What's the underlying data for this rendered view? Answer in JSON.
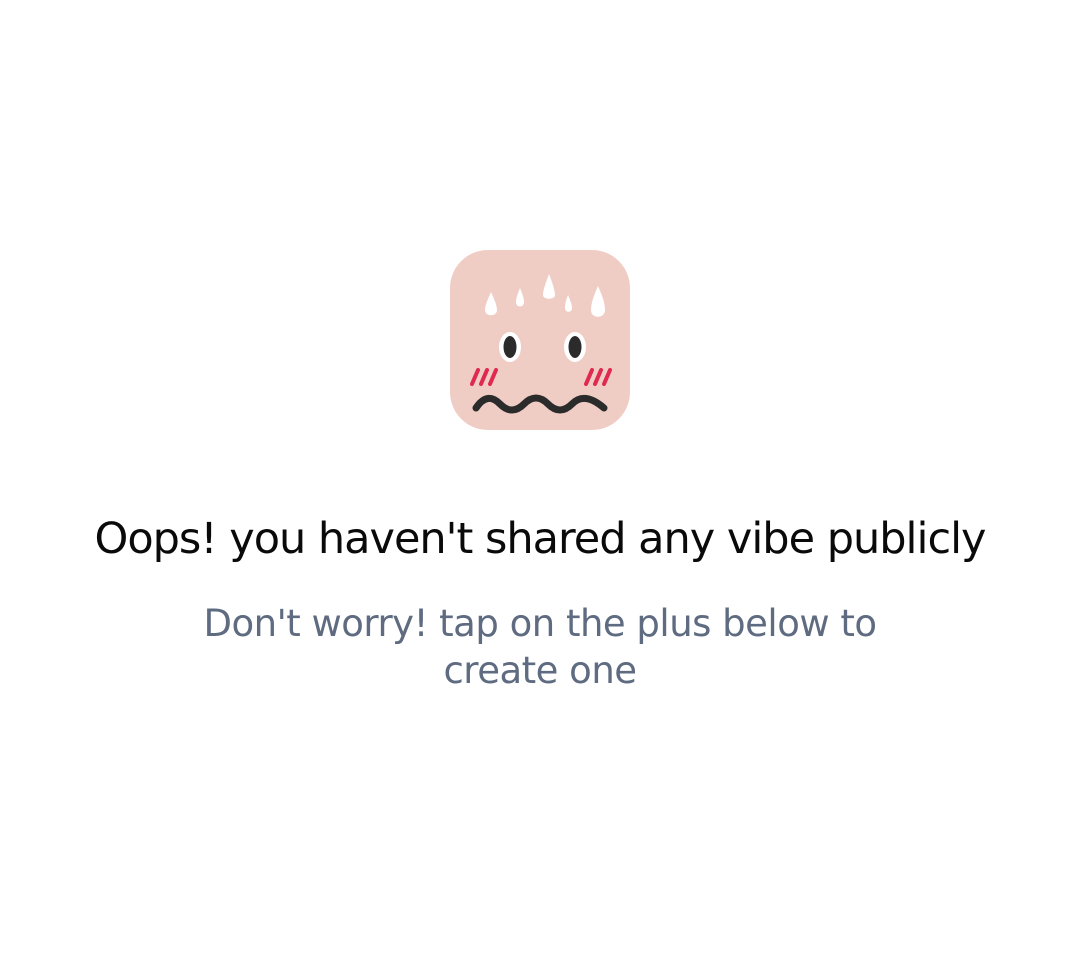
{
  "empty_state": {
    "icon": "worried-face-icon",
    "title": "Oops! you haven't shared any vibe publicly",
    "subtitle": "Don't worry! tap on the plus below to create one"
  },
  "colors": {
    "background": "#ffffff",
    "icon_background": "#f0cdc4",
    "blush": "#e0294f",
    "title_text": "#0a0a0a",
    "subtitle_text": "#5e6b80"
  }
}
